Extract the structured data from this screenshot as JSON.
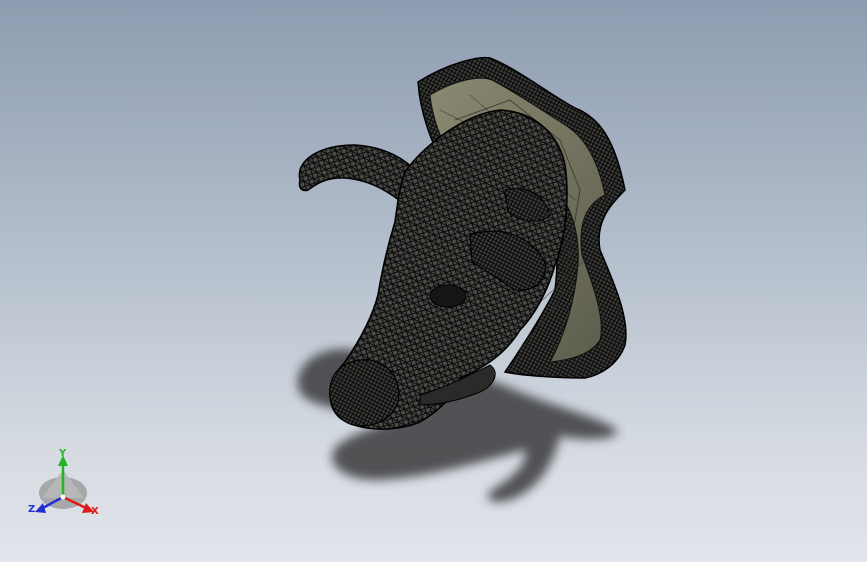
{
  "viewport": {
    "background_top": "#8e9cb1",
    "background_bottom": "#e1e4ea",
    "model": "mesh-bull-head-trophy-icon"
  },
  "triad": {
    "x_label": "X",
    "y_label": "Y",
    "z_label": "Z",
    "x_color": "#e01919",
    "y_color": "#24b524",
    "z_color": "#2430d0"
  }
}
